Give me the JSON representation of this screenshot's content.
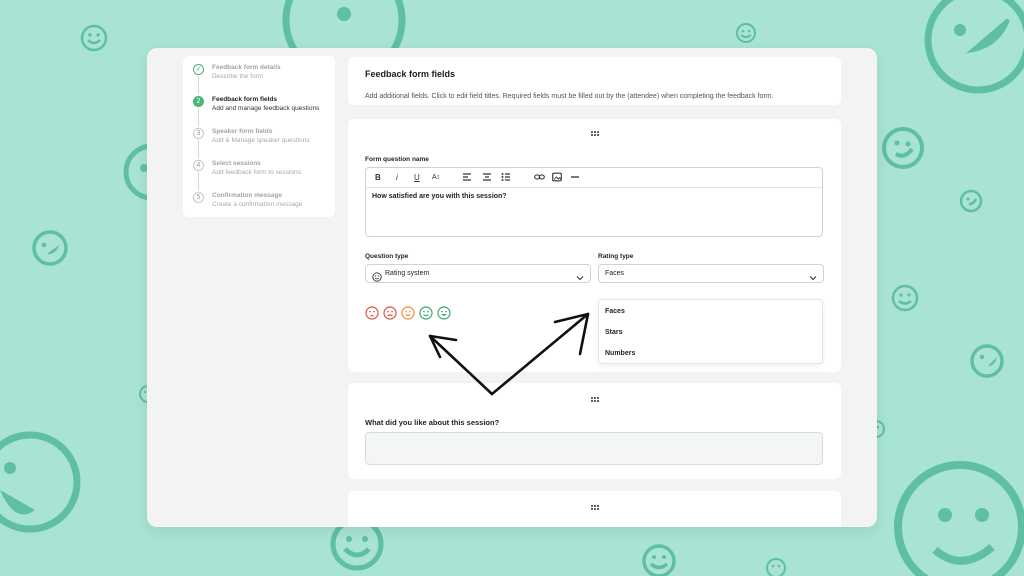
{
  "colors": {
    "background": "#a8e3d4",
    "smiley": "#5ebfa3",
    "accent_green": "#47b877",
    "face_red": "#e0513f",
    "face_orange": "#ef8a3c",
    "face_green": "#3aa66d"
  },
  "stepper": {
    "steps": [
      {
        "title": "Feedback form details",
        "subtitle": "Describe the form",
        "state": "done",
        "marker": "✓"
      },
      {
        "title": "Feedback form fields",
        "subtitle": "Add and manage feedback questions",
        "state": "active",
        "marker": "2"
      },
      {
        "title": "Speaker form fields",
        "subtitle": "Add & Manage speaker questions",
        "state": "upcoming",
        "marker": "3"
      },
      {
        "title": "Select sessions",
        "subtitle": "Add feedback form to sessions",
        "state": "upcoming",
        "marker": "4"
      },
      {
        "title": "Confirmation message",
        "subtitle": "Create a confirmation message",
        "state": "upcoming",
        "marker": "5"
      }
    ]
  },
  "header": {
    "title": "Feedback form fields",
    "subtitle": "Add additional fields. Click to edit field titles. Required fields must be filled out by the (attendee) when completing the feedback form."
  },
  "question1": {
    "name_label": "Form question name",
    "toolbar": {
      "bold": "B",
      "italic": "i",
      "underline": "U",
      "text_size": "A↕"
    },
    "text": "How satisfied are you with this session?",
    "question_type_label": "Question type",
    "question_type_value": "Rating system",
    "rating_type_label": "Rating type",
    "rating_type_value": "Faces",
    "rating_options": [
      "Faces",
      "Stars",
      "Numbers"
    ],
    "face_icons": [
      "very-sad-face-icon",
      "sad-face-icon",
      "neutral-face-icon",
      "happy-face-icon",
      "very-happy-face-icon"
    ]
  },
  "question2": {
    "title": "What did you like about this session?"
  }
}
